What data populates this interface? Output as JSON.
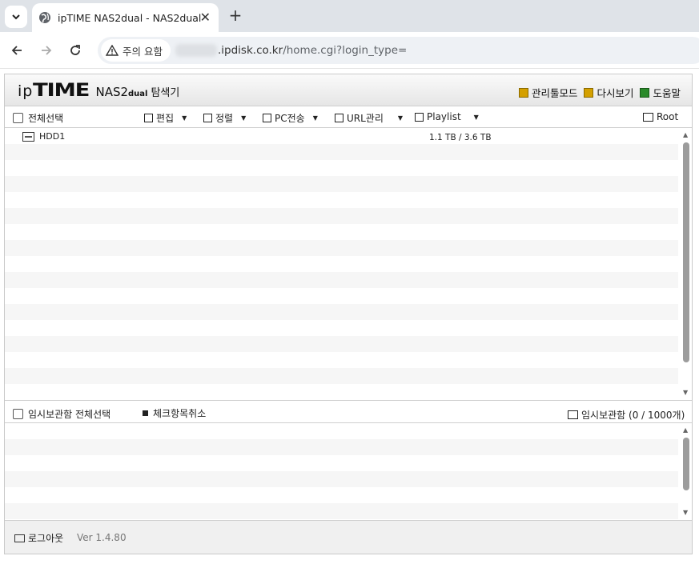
{
  "browser": {
    "tab_title": "ipTIME NAS2dual - NAS2dual",
    "security_chip": "주의 요함",
    "url_host": ".ipdisk.co.kr",
    "url_path": "/home.cgi?login_type="
  },
  "app": {
    "logo": {
      "ip": "ip",
      "time": "TIME",
      "model": "NAS2",
      "model_sub": "dual",
      "suffix": "탐색기"
    },
    "header_links": [
      "관리툴모드",
      "다시보기",
      "도움말"
    ],
    "toolbar": {
      "select_all": "전체선택",
      "edit": "편집",
      "sort": "정렬",
      "pc_transfer": "PC전송",
      "url_manage": "URL관리",
      "playlist": "Playlist",
      "root": "Root"
    },
    "files": [
      {
        "name": "HDD1",
        "size": "1.1 TB / 3.6 TB"
      }
    ],
    "tempbox": {
      "select_all": "임시보관함 전체선택",
      "uncheck": "체크항목취소",
      "title": "임시보관함 (0 / 1000개)"
    },
    "footer": {
      "logout": "로그아웃",
      "version": "Ver 1.4.80"
    }
  },
  "colors": {
    "accent_yellow": "#d4a000",
    "help_green": "#2a8a2a",
    "scroll_thumb": "#9c9c9c"
  }
}
